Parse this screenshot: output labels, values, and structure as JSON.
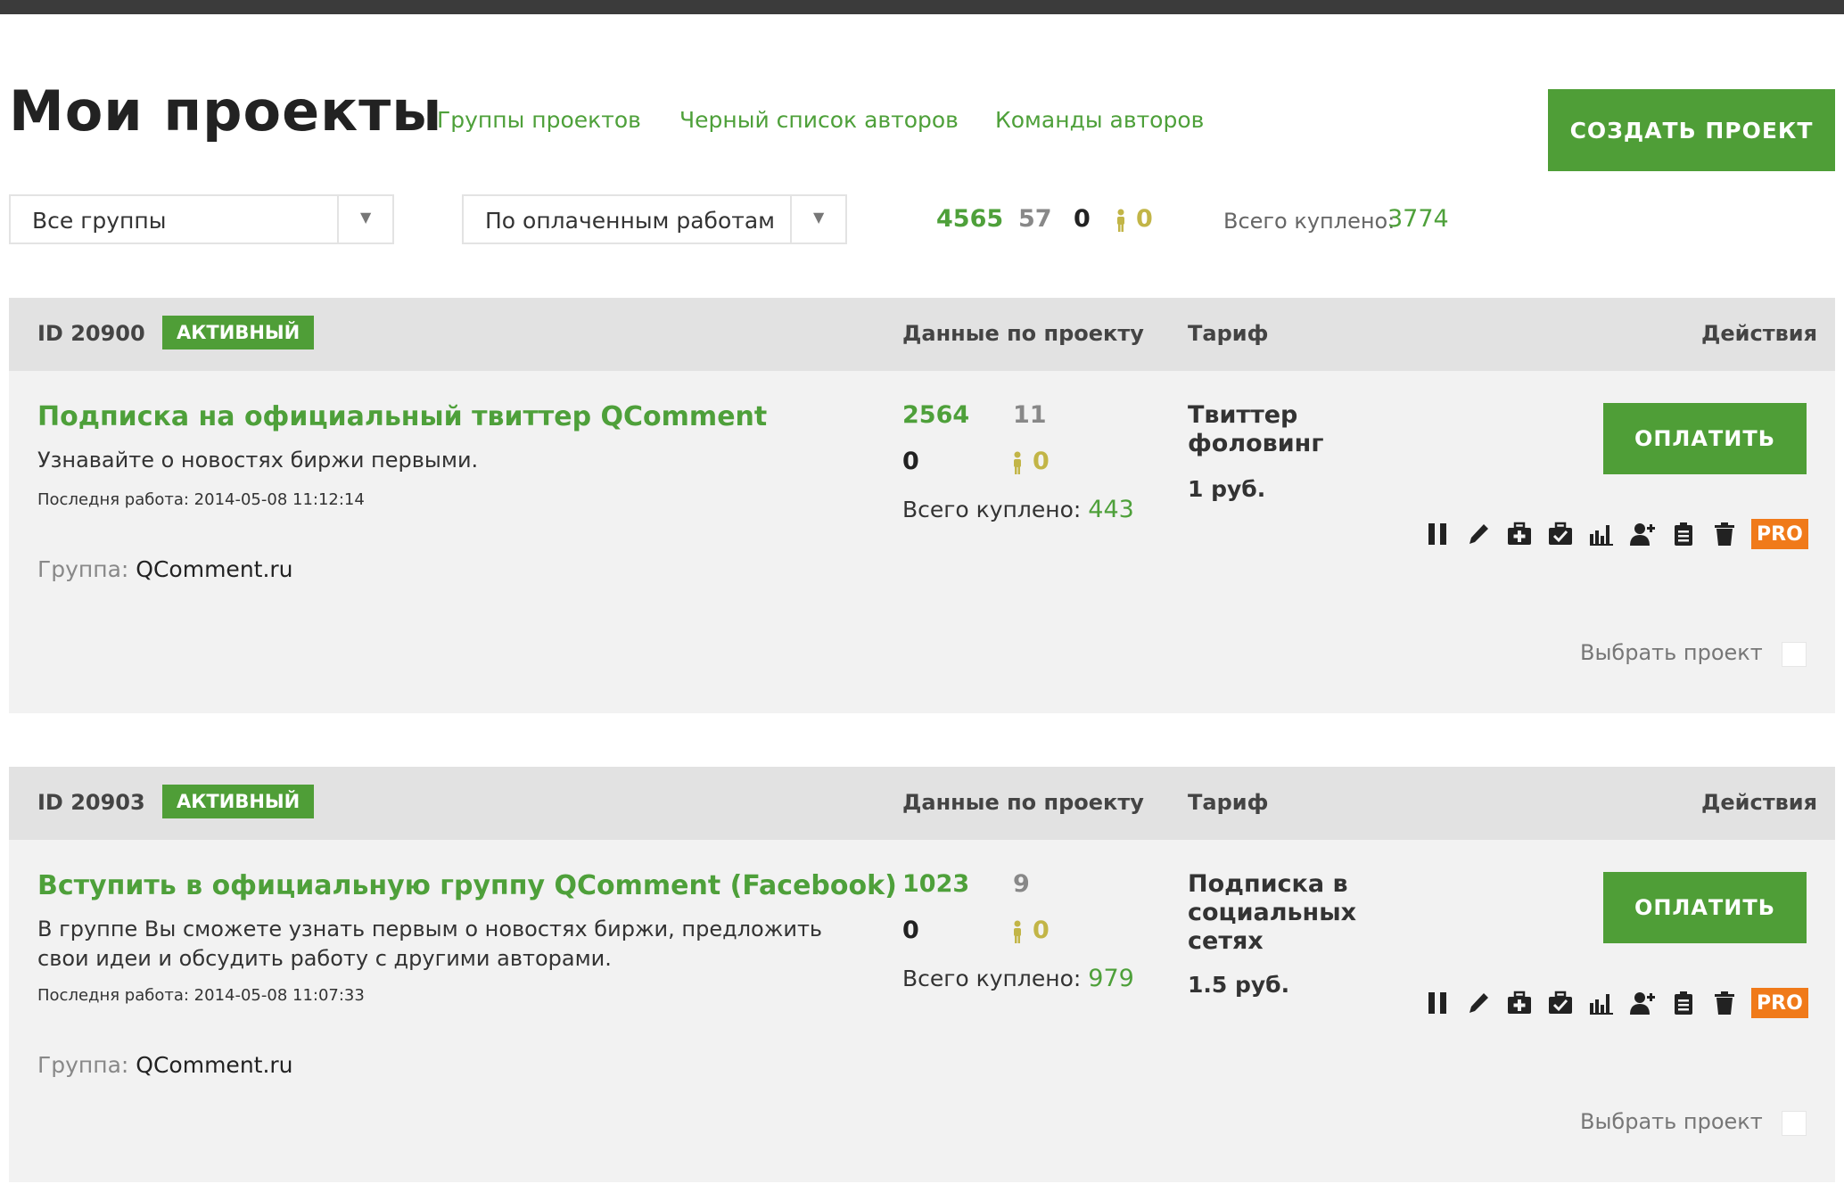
{
  "header": {
    "title": "Мои проекты",
    "nav": [
      "Группы проектов",
      "Черный список авторов",
      "Команды авторов"
    ],
    "create_button": "СОЗДАТЬ ПРОЕКТ"
  },
  "filters": {
    "group_select": "Все группы",
    "sort_select": "По оплаченным работам"
  },
  "stats": {
    "paid": "4565",
    "pending": "57",
    "rejected": "0",
    "workers": "0",
    "total_bought_label": "Всего куплено:",
    "total_bought_value": "3774"
  },
  "columns": {
    "data": "Данные по проекту",
    "tariff": "Тариф",
    "actions": "Действия"
  },
  "projects": [
    {
      "id": "ID 20900",
      "status": "АКТИВНЫЙ",
      "title": "Подписка на официальный твиттер QComment",
      "description": "Узнавайте о новостях биржи первыми.",
      "last_work": "Последня работа: 2014-05-08 11:12:14",
      "group_label": "Группа:",
      "group_value": "QComment.ru",
      "paid": "2564",
      "pending": "11",
      "rejected": "0",
      "workers": "0",
      "bought_label": "Всего куплено:",
      "bought_value": "443",
      "tariff": "Твиттер фоловинг",
      "price": "1 руб.",
      "pay_button": "ОПЛАТИТЬ",
      "pro_label": "PRO",
      "select_label": "Выбрать проект"
    },
    {
      "id": "ID 20903",
      "status": "АКТИВНЫЙ",
      "title": "Вступить в официальную группу QComment (Facebook)",
      "description": "В группе Вы сможете узнать первым о новостях биржи, предложить свои идеи и обсудить работу с другими авторами.",
      "last_work": "Последня работа: 2014-05-08 11:07:33",
      "group_label": "Группа:",
      "group_value": "QComment.ru",
      "paid": "1023",
      "pending": "9",
      "rejected": "0",
      "workers": "0",
      "bought_label": "Всего куплено:",
      "bought_value": "979",
      "tariff": "Подписка в социальных сетях",
      "price": "1.5 руб.",
      "pay_button": "ОПЛАТИТЬ",
      "pro_label": "PRO",
      "select_label": "Выбрать проект"
    }
  ],
  "colors": {
    "accent_green": "#4f9e37",
    "link_green": "#4ea03a",
    "pro_orange": "#f07a1a",
    "worker_olive": "#c2b547"
  }
}
